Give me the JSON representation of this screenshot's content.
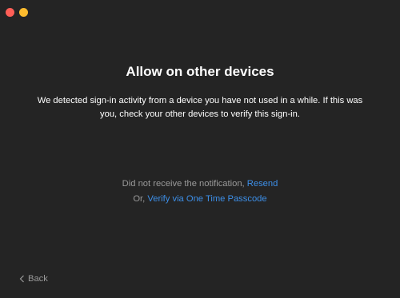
{
  "window": {
    "controls": [
      "close",
      "minimize"
    ],
    "colors": {
      "background": "#242424",
      "close": "#ff5f57",
      "minimize": "#febc2e",
      "link": "#3d8fe8",
      "muted": "#9a9a9a"
    }
  },
  "main": {
    "title": "Allow on other devices",
    "description": "We detected sign-in activity from a device you have not used in a while. If this was you, check your other devices to verify this sign-in."
  },
  "notification": {
    "prefix": "Did not receive the notification, ",
    "resend_label": "Resend"
  },
  "otp": {
    "prefix": "Or, ",
    "link_label": "Verify via One Time Passcode"
  },
  "footer": {
    "back_icon": "chevron-left-icon",
    "back_label": "Back"
  }
}
